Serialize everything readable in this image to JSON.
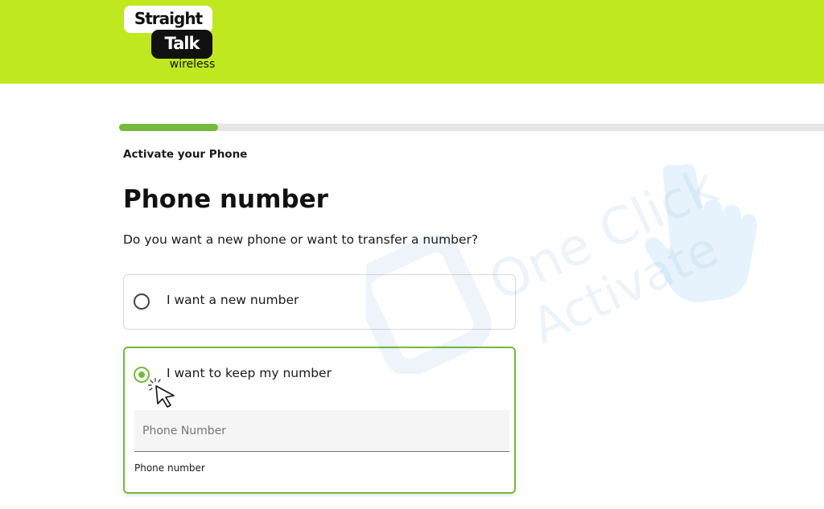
{
  "brand": {
    "logo_line1": "Straight",
    "logo_line2": "Talk",
    "logo_line3": "wireless",
    "header_color": "#bfe81e",
    "accent_color": "#76b940"
  },
  "progress": {
    "fraction": 0.14
  },
  "page": {
    "step_label": "Activate your Phone",
    "title": "Phone number",
    "question": "Do you want a new phone or want to transfer a number?"
  },
  "options": [
    {
      "label": "I want a new number",
      "selected": false
    },
    {
      "label": "I want to keep my number",
      "selected": true
    }
  ],
  "phone_field": {
    "placeholder": "Phone Number",
    "value": "",
    "helper": "Phone number"
  },
  "watermark": {
    "line1": "One Click",
    "line2": "Activate"
  },
  "icons": {
    "cursor": "pointer-arrow-icon",
    "watermark_hand": "hand-pointer-icon"
  }
}
